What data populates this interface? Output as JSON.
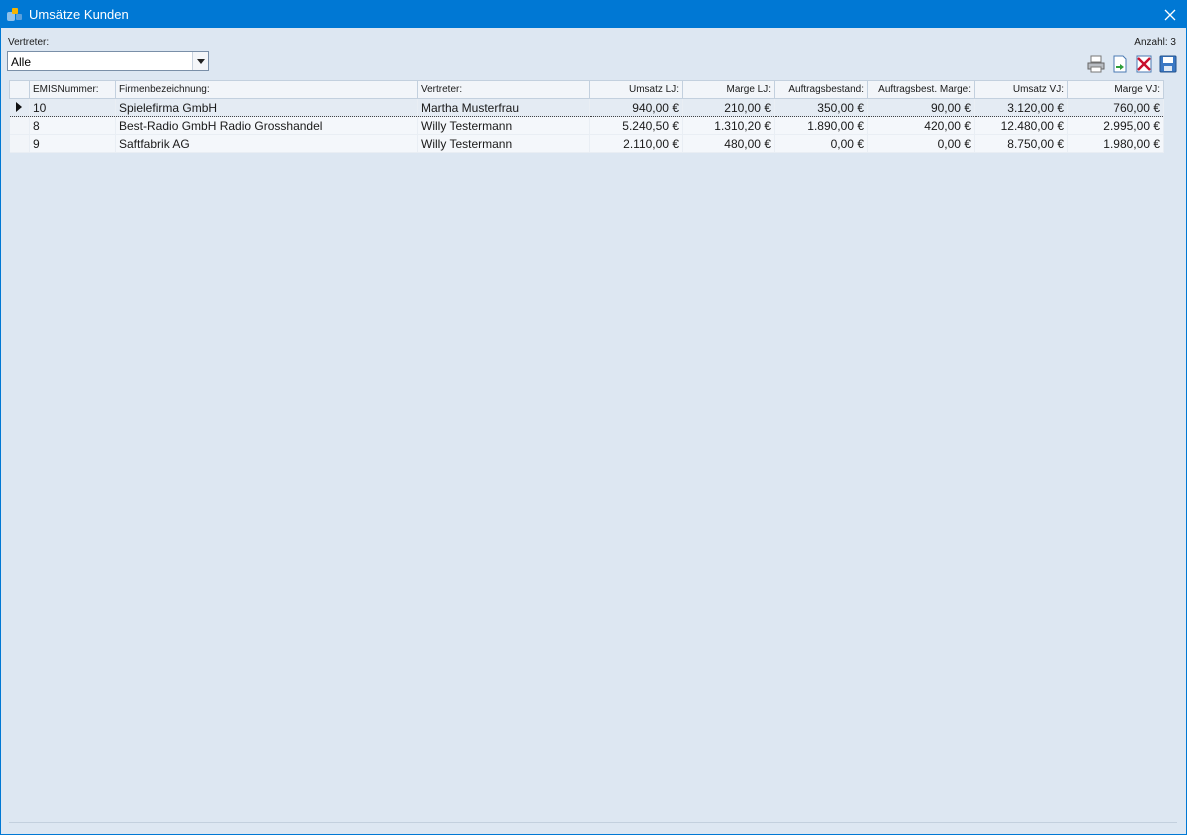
{
  "window": {
    "title": "Umsätze Kunden"
  },
  "filter": {
    "label": "Vertreter:",
    "selected": "Alle"
  },
  "count_label": "Anzahl: 3",
  "toolbar": {
    "items": [
      "printer-icon",
      "export-icon",
      "delete-icon",
      "save-icon"
    ]
  },
  "table": {
    "headers": [
      "EMISNummer:",
      "Firmenbezeichnung:",
      "Vertreter:",
      "Umsatz LJ:",
      "Marge LJ:",
      "Auftragsbestand:",
      "Auftragsbest. Marge:",
      "Umsatz VJ:",
      "Marge VJ:"
    ],
    "rows": [
      [
        "10",
        "Spielefirma GmbH",
        "Martha Musterfrau",
        "940,00 €",
        "210,00 €",
        "350,00 €",
        "90,00 €",
        "3.120,00 €",
        "760,00 €"
      ],
      [
        "8",
        "Best-Radio GmbH Radio Grosshandel",
        "Willy Testermann",
        "5.240,50 €",
        "1.310,20 €",
        "1.890,00 €",
        "420,00 €",
        "12.480,00 €",
        "2.995,00 €"
      ],
      [
        "9",
        "Saftfabrik AG",
        "Willy Testermann",
        "2.110,00 €",
        "480,00 €",
        "0,00 €",
        "0,00 €",
        "8.750,00 €",
        "1.980,00 €"
      ]
    ],
    "selected_row": 0
  },
  "colors": {
    "titlebar": "#0078d4",
    "background": "#dde7f2"
  }
}
